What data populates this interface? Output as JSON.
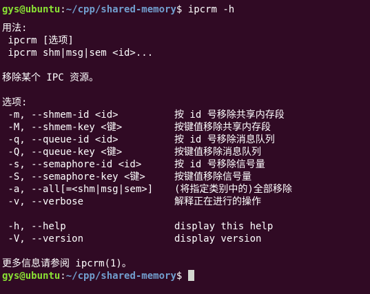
{
  "colors": {
    "background": "#300a24",
    "prompt_user": "#8ae234",
    "prompt_path": "#729fcf",
    "text": "#ffffff"
  },
  "prompt": {
    "user_host": "gys@ubuntu",
    "colon": ":",
    "path": "~/cpp/shared-memory",
    "symbol": "$"
  },
  "command": "ipcrm -h",
  "usage": {
    "title": "用法:",
    "lines": [
      " ipcrm [选项]",
      " ipcrm shm|msg|sem <id>..."
    ]
  },
  "description": "移除某个 IPC 资源。",
  "options": {
    "title": "选项:",
    "items": [
      {
        "flag": " -m, --shmem-id <id>",
        "desc": "按 id 号移除共享内存段"
      },
      {
        "flag": " -M, --shmem-key <键>",
        "desc": "按键值移除共享内存段"
      },
      {
        "flag": " -q, --queue-id <id>",
        "desc": "按 id 号移除消息队列"
      },
      {
        "flag": " -Q, --queue-key <键>",
        "desc": "按键值移除消息队列"
      },
      {
        "flag": " -s, --semaphore-id <id>",
        "desc": "按 id 号移除信号量"
      },
      {
        "flag": " -S, --semaphore-key <键>",
        "desc": "按键值移除信号量"
      },
      {
        "flag": " -a, --all[=<shm|msg|sem>]",
        "desc": "(将指定类别中的)全部移除"
      },
      {
        "flag": " -v, --verbose",
        "desc": "解释正在进行的操作"
      }
    ],
    "help_items": [
      {
        "flag": " -h, --help",
        "desc": "display this help"
      },
      {
        "flag": " -V, --version",
        "desc": "display version"
      }
    ]
  },
  "footer": "更多信息请参阅 ipcrm(1)。"
}
